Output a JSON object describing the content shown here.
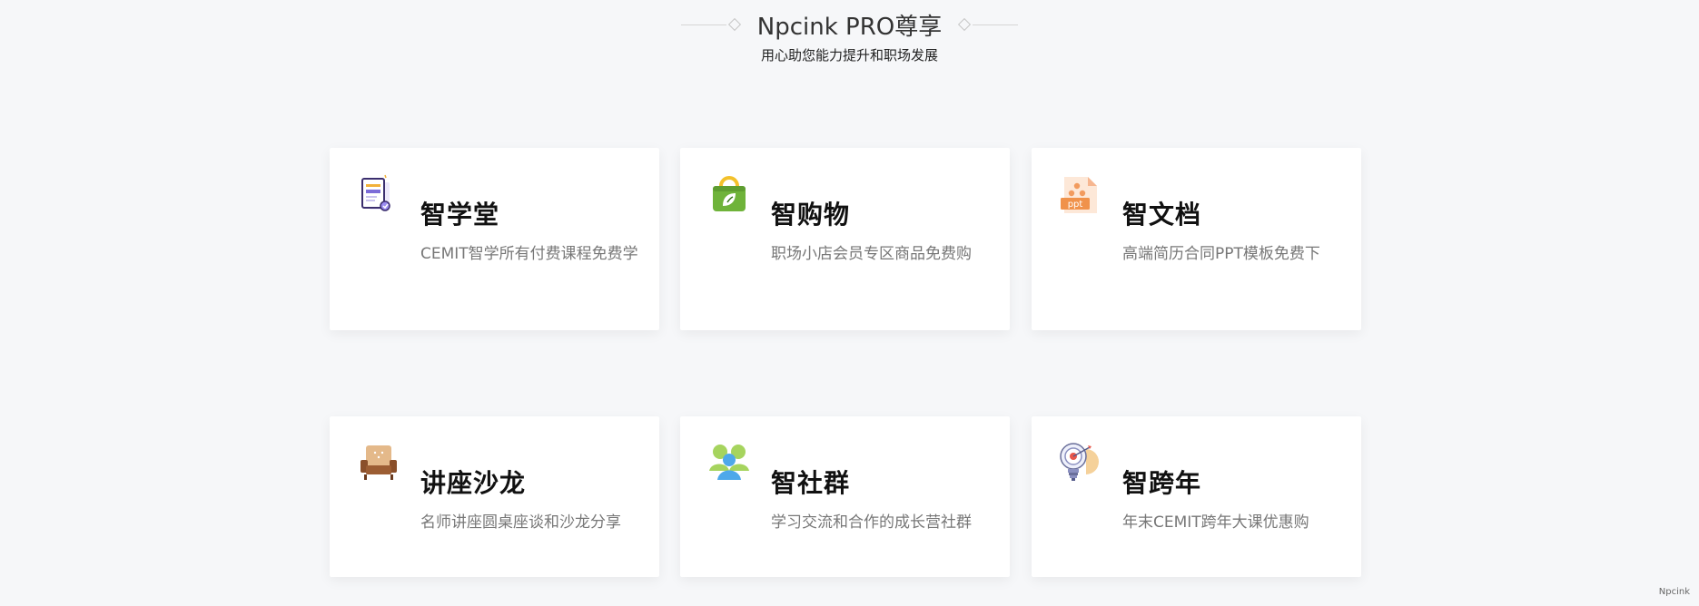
{
  "header": {
    "title": "Npcink PRO尊享",
    "subtitle": "用心助您能力提升和职场发展"
  },
  "cards": [
    {
      "title": "智学堂",
      "desc": "CEMIT智学所有付费课程免费学",
      "icon": "course-icon"
    },
    {
      "title": "智购物",
      "desc": "职场小店会员专区商品免费购",
      "icon": "shopping-bag-icon"
    },
    {
      "title": "智文档",
      "desc": "高端简历合同PPT模板免费下",
      "icon": "ppt-document-icon",
      "icon_text": "ppt"
    },
    {
      "title": "讲座沙龙",
      "desc": "名师讲座圆桌座谈和沙龙分享",
      "icon": "sofa-icon"
    },
    {
      "title": "智社群",
      "desc": "学习交流和合作的成长营社群",
      "icon": "community-icon"
    },
    {
      "title": "智跨年",
      "desc": "年末CEMIT跨年大课优惠购",
      "icon": "target-bulb-icon"
    }
  ],
  "footer": {
    "brand": "Npcink"
  }
}
